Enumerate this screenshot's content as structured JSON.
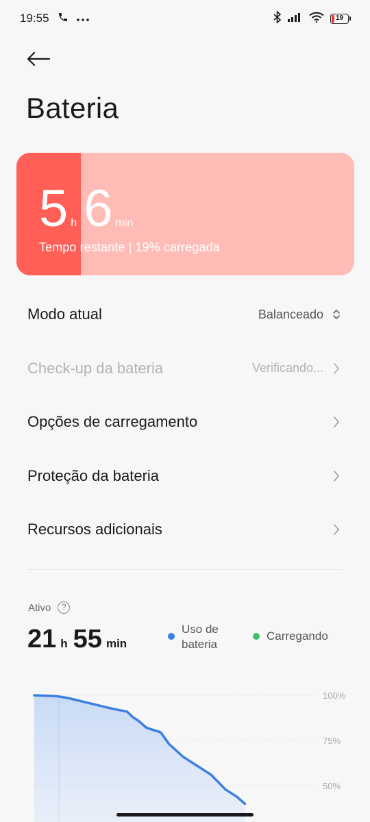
{
  "status_bar": {
    "time": "19:55",
    "battery_level": "19",
    "battery_fraction": 0.19
  },
  "page": {
    "title": "Bateria"
  },
  "battery_card": {
    "hours": "5",
    "hours_unit": "h",
    "minutes": "6",
    "minutes_unit": "min",
    "subtitle": "Tempo restante | 19% carregada",
    "charge_fraction": 0.19,
    "colors": {
      "fill": "#ff5f57",
      "background": "#ffbcb7"
    }
  },
  "settings": {
    "items": [
      {
        "label": "Modo atual",
        "value": "Balanceado",
        "icon": "up-down-chevron-icon",
        "disabled": false
      },
      {
        "label": "Check-up da bateria",
        "value": "Verificando...",
        "icon": "chevron-right-icon",
        "disabled": true
      },
      {
        "label": "Opções de carregamento",
        "value": "",
        "icon": "chevron-right-icon",
        "disabled": false
      },
      {
        "label": "Proteção da bateria",
        "value": "",
        "icon": "chevron-right-icon",
        "disabled": false
      },
      {
        "label": "Recursos adicionais",
        "value": "",
        "icon": "chevron-right-icon",
        "disabled": false
      }
    ]
  },
  "usage": {
    "active_label": "Ativo",
    "help_icon": "?",
    "hours": "21",
    "hours_unit": "h",
    "minutes": "55",
    "minutes_unit": "min",
    "legend": {
      "usage": "Uso de bateria",
      "charging": "Carregando",
      "usage_color": "#3b7fe0",
      "charging_color": "#3dc26b"
    }
  },
  "chart_data": {
    "type": "area",
    "y_tick_labels": [
      "100%",
      "75%",
      "50%"
    ],
    "ylim": [
      0,
      100
    ],
    "grid": true,
    "series": [
      {
        "name": "Uso de bateria",
        "color": "#3b7fe0",
        "points": [
          [
            0,
            100
          ],
          [
            8,
            99.5
          ],
          [
            12,
            98.5
          ],
          [
            20,
            95.5
          ],
          [
            28,
            92.5
          ],
          [
            33,
            91
          ],
          [
            35,
            88
          ],
          [
            37,
            86
          ],
          [
            40,
            82
          ],
          [
            42,
            81
          ],
          [
            45,
            79.5
          ],
          [
            48,
            73
          ],
          [
            53,
            66
          ],
          [
            63,
            56
          ],
          [
            68,
            48
          ],
          [
            72,
            44
          ],
          [
            75,
            40
          ]
        ]
      }
    ],
    "xlim": [
      0,
      100
    ]
  }
}
